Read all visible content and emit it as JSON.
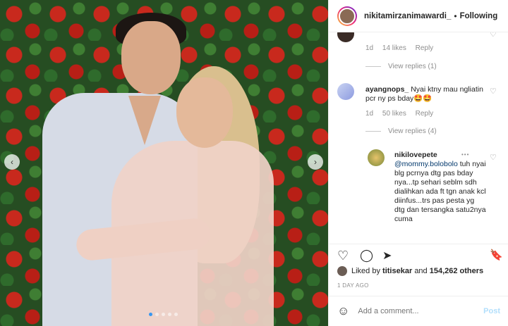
{
  "header": {
    "username": "nikitamirzanimawardi_",
    "separator": "•",
    "follow_label": "Following"
  },
  "comments": [
    {
      "meta": {
        "time": "1d",
        "likes": "14 likes",
        "reply": "Reply"
      },
      "view_replies": "View replies (1)"
    },
    {
      "username": "ayangnops_",
      "text": "Nyai ktny mau ngliatin pcr ny ps bday🤩🤩",
      "meta": {
        "time": "1d",
        "likes": "50 likes",
        "reply": "Reply"
      },
      "view_replies": "View replies (4)"
    },
    {
      "username": "nikilovepete",
      "mention": "@mommy.bolobolo",
      "text": "tuh nyai blg pcrnya dtg pas bday nya...tp sehari seblm sdh dialihkan ada ft tgn anak kcl diinfus...trs pas pesta yg dtg dan tersangka satu2nya cuma",
      "more_icon": "•••"
    }
  ],
  "likes": {
    "prefix": "Liked by",
    "user": "titisekar",
    "joiner": "and",
    "count": "154,262 others"
  },
  "time_ago": "1 DAY AGO",
  "add_comment": {
    "placeholder": "Add a comment...",
    "post_label": "Post"
  },
  "icons": {
    "heart": "♡",
    "comment": "◯",
    "share": "➤",
    "bookmark": "🔖",
    "emoji": "☺",
    "arrow_left": "‹",
    "arrow_right": "›"
  },
  "colors": {
    "accent": "#3897f0",
    "post_disabled": "#b2dffc",
    "muted": "#8e8e8e"
  },
  "carousel": {
    "count": 5,
    "active": 0
  }
}
